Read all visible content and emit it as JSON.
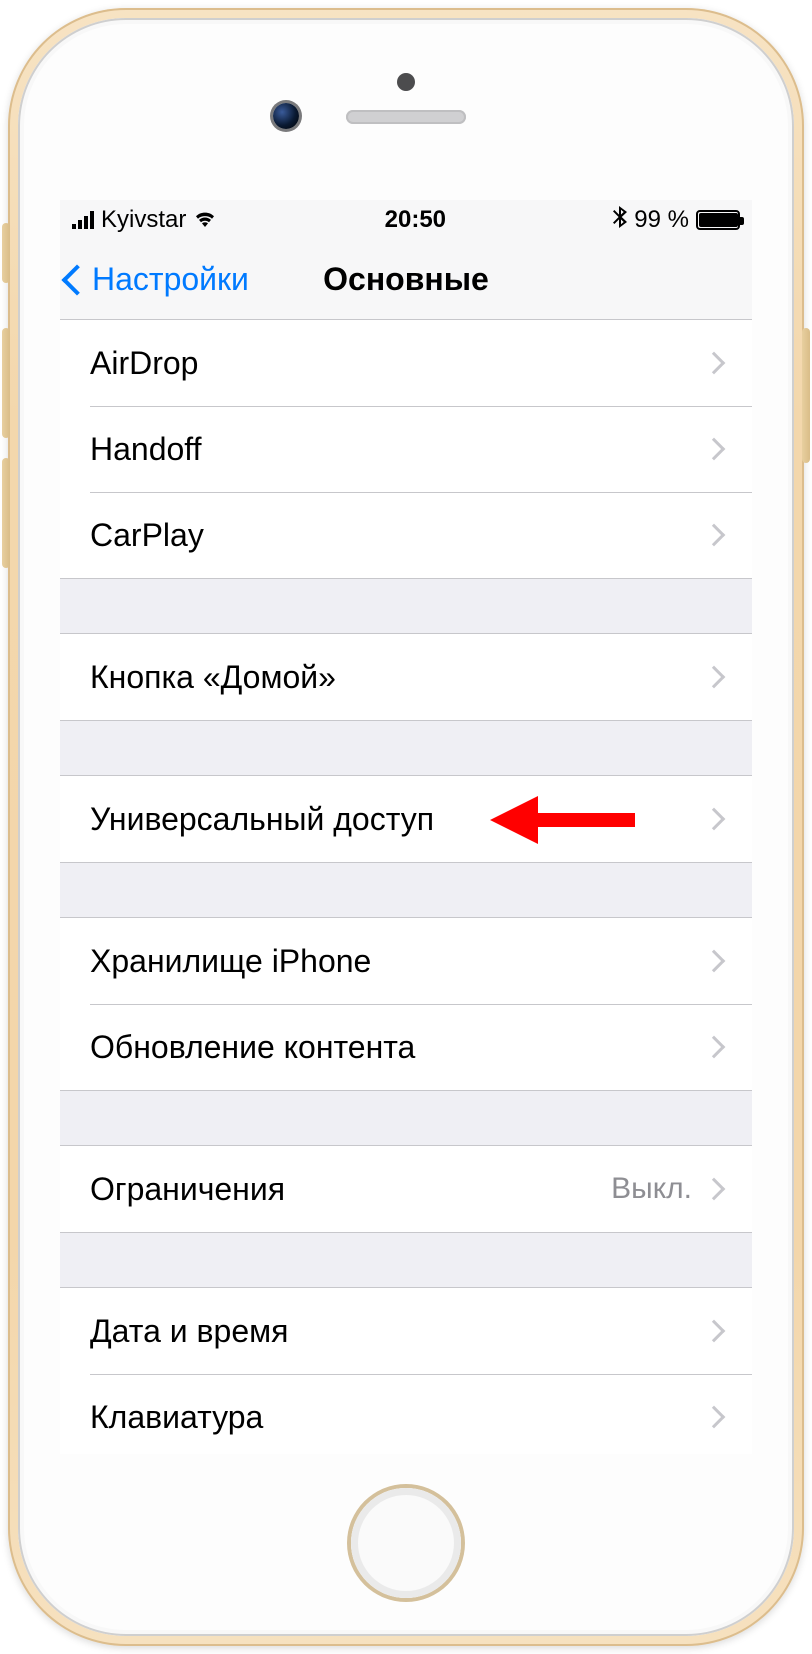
{
  "status": {
    "carrier": "Kyivstar",
    "time": "20:50",
    "battery_pct": "99 %"
  },
  "nav": {
    "back_label": "Настройки",
    "title": "Основные"
  },
  "groups": [
    {
      "rows": [
        {
          "label": "AirDrop"
        },
        {
          "label": "Handoff"
        },
        {
          "label": "CarPlay"
        }
      ]
    },
    {
      "rows": [
        {
          "label": "Кнопка «Домой»"
        }
      ]
    },
    {
      "rows": [
        {
          "label": "Универсальный доступ",
          "annotated": true
        }
      ]
    },
    {
      "rows": [
        {
          "label": "Хранилище iPhone"
        },
        {
          "label": "Обновление контента"
        }
      ]
    },
    {
      "rows": [
        {
          "label": "Ограничения",
          "detail": "Выкл."
        }
      ]
    },
    {
      "rows": [
        {
          "label": "Дата и время"
        },
        {
          "label": "Клавиатура"
        }
      ]
    }
  ]
}
